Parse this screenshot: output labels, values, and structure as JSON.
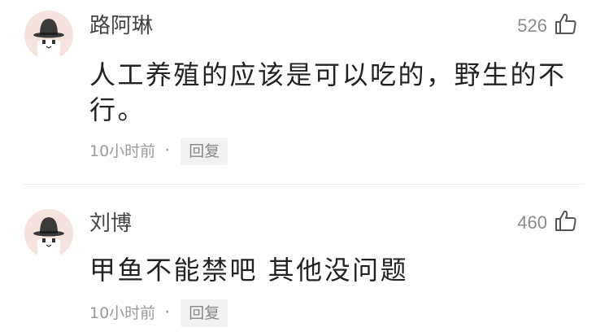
{
  "comments": [
    {
      "username": "路阿琳",
      "likes": "526",
      "content": "人工养殖的应该是可以吃的，野生的不行。",
      "time": "10小时前",
      "dot": "·",
      "reply_label": "回复",
      "avatar_icon": "default-user-avatar-icon",
      "like_icon": "thumbs-up-icon"
    },
    {
      "username": "刘博",
      "likes": "460",
      "content": "甲鱼不能禁吧 其他没问题",
      "time": "10小时前",
      "dot": "·",
      "reply_label": "回复",
      "avatar_icon": "default-user-avatar-icon",
      "like_icon": "thumbs-up-icon"
    }
  ],
  "colors": {
    "avatar_bg": "#f5e3dc",
    "text_main": "#222222",
    "text_meta": "#9a9a9a",
    "reply_bg": "#f2f2f2"
  }
}
